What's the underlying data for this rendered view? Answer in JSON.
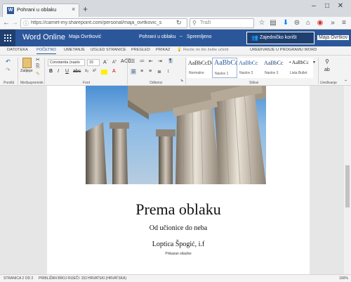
{
  "browser": {
    "tab_title": "Pohrani u oblaku",
    "url": "https://carnet-my.sharepoint.com/personal/maja_ovrtkovic_s",
    "search_placeholder": "Traži"
  },
  "word": {
    "app_name": "Word Online",
    "user_breadcrumb": "Maja Ovrtković",
    "doc_title": "Pohrani u oblaku",
    "separator": "–",
    "save_status": "Spremljeno",
    "share_label": "Zajedničko korišt",
    "account": "Maja Ovrtkov"
  },
  "ribbon_tabs": [
    "DATOTEKA",
    "POČETNO",
    "UMETANJE",
    "IZGLED STRANICE",
    "PREGLED",
    "PRIKAZ",
    "Recite mi što želite učiniti",
    "UREĐIVANJE U PROGRAMU WORD"
  ],
  "ribbon": {
    "undo_group": "Poništi",
    "clipboard_group": "Međuspremnik",
    "paste_label": "Zalijepi",
    "font_group": "Font",
    "font_name": "Constantia (naslo",
    "font_size": "15",
    "paragraph_group": "Odlomci",
    "styles_group": "Stilovi",
    "editing_group": "Uređivanje",
    "styles": [
      {
        "preview": "AaBbCcDc",
        "name": "Normalno"
      },
      {
        "preview": "AaBbCc",
        "name": "Naslov 1"
      },
      {
        "preview": "AaBbCc",
        "name": "Naslov 2"
      },
      {
        "preview": "AaBbCc",
        "name": "Naslov 3"
      },
      {
        "preview": "• AaBbCc",
        "name": "Lista Bullet"
      }
    ]
  },
  "document": {
    "title": "Prema oblaku",
    "subtitle": "Od učionice do neba",
    "author": "Loptica Špogić, i.f",
    "presenter": "Prikazan sliacike"
  },
  "status": {
    "page": "STRANICA 2 OD 2",
    "words": "PRIBLIŽAN BROJ RIJEČI: 152",
    "language": "HRVATSKI (HRVATSKA)",
    "zoom": "100%"
  },
  "colors": {
    "word_blue": "#2b579a",
    "ribbon_bg": "#f3f3f3"
  }
}
